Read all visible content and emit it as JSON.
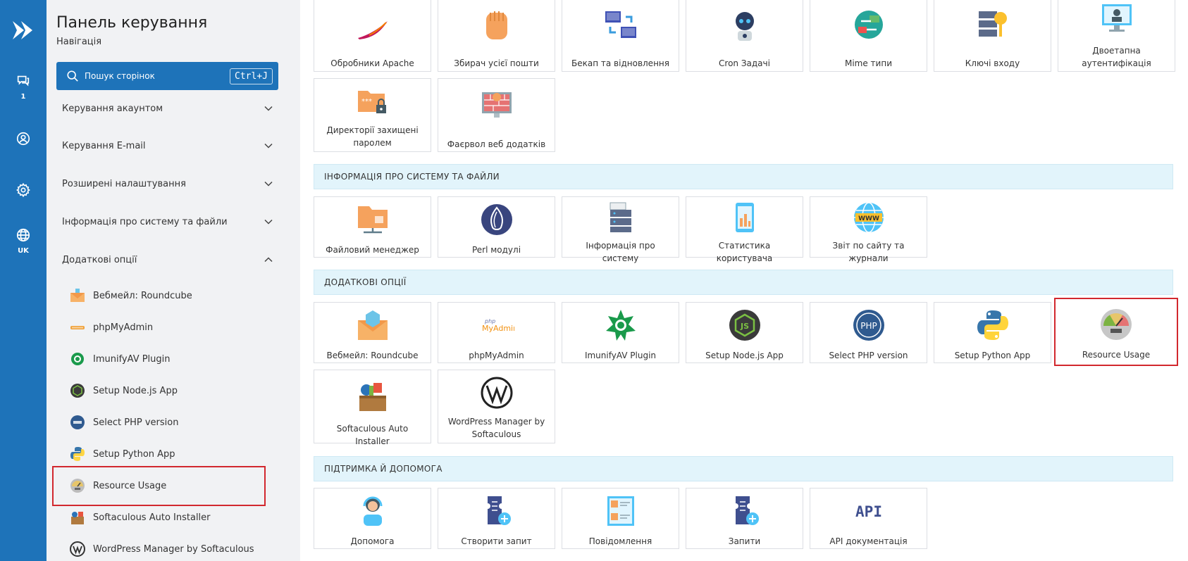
{
  "rail": {
    "chat_count": "1",
    "language": "UK"
  },
  "sidebar": {
    "title": "Панель керування",
    "subtitle": "Навігація",
    "search_placeholder": "Пошук сторінок",
    "search_shortcut": "Ctrl+J",
    "sections": [
      {
        "label": "Керування акаунтом"
      },
      {
        "label": "Керування E-mail"
      },
      {
        "label": "Розширені налаштування"
      },
      {
        "label": "Інформація про систему та файли"
      },
      {
        "label": "Додаткові опції"
      }
    ],
    "sub_items": [
      {
        "label": "Вебмейл: Roundcube"
      },
      {
        "label": "phpMyAdmin"
      },
      {
        "label": "ImunifyAV Plugin"
      },
      {
        "label": "Setup Node.js App"
      },
      {
        "label": "Select PHP version"
      },
      {
        "label": "Setup Python App"
      },
      {
        "label": "Resource Usage"
      },
      {
        "label": "Softaculous Auto Installer"
      },
      {
        "label": "WordPress Manager by Softaculous"
      }
    ]
  },
  "main": {
    "security_tiles": [
      {
        "label": "Обробники Apache"
      },
      {
        "label": "Збирач усієї пошти"
      },
      {
        "label": "Бекап та відновлення"
      },
      {
        "label": "Cron Задачі"
      },
      {
        "label": "Mime типи"
      },
      {
        "label": "Ключі входу"
      },
      {
        "label": "Двоетапна аутентифікація"
      },
      {
        "label": "Директорії захищені паролем"
      },
      {
        "label": "Фаєрвол веб додатків"
      }
    ],
    "sections": [
      {
        "label": "ІНФОРМАЦІЯ ПРО СИСТЕМУ ТА ФАЙЛИ"
      },
      {
        "label": "ДОДАТКОВІ ОПЦІЇ"
      },
      {
        "label": "ПІДТРИМКА Й ДОПОМОГА"
      }
    ],
    "info_tiles": [
      {
        "label": "Файловий менеджер"
      },
      {
        "label": "Perl модулі"
      },
      {
        "label": "Інформація про систему"
      },
      {
        "label": "Статистика користувача"
      },
      {
        "label": "Звіт по сайту та журнали"
      }
    ],
    "extra_tiles": [
      {
        "label": "Вебмейл: Roundcube"
      },
      {
        "label": "phpMyAdmin"
      },
      {
        "label": "ImunifyAV Plugin"
      },
      {
        "label": "Setup Node.js App"
      },
      {
        "label": "Select PHP version"
      },
      {
        "label": "Setup Python App"
      },
      {
        "label": "Resource Usage"
      },
      {
        "label": "Softaculous Auto Installer"
      },
      {
        "label": "WordPress Manager by Softaculous"
      }
    ],
    "support_tiles": [
      {
        "label": "Допомога"
      },
      {
        "label": "Створити запит"
      },
      {
        "label": "Повідомлення"
      },
      {
        "label": "Запити"
      },
      {
        "label": "API документація"
      }
    ],
    "phpmyadmin_logo": {
      "small": "php",
      "big": "MyAdmin"
    },
    "php_badge": "PHP",
    "js_badge": "JS",
    "www_badge": "WWW",
    "api_badge": "API",
    "password_dots": "***"
  },
  "colors": {
    "rail": "#1e73b9",
    "highlight": "#d2282e",
    "band": "#e2f4fb"
  }
}
